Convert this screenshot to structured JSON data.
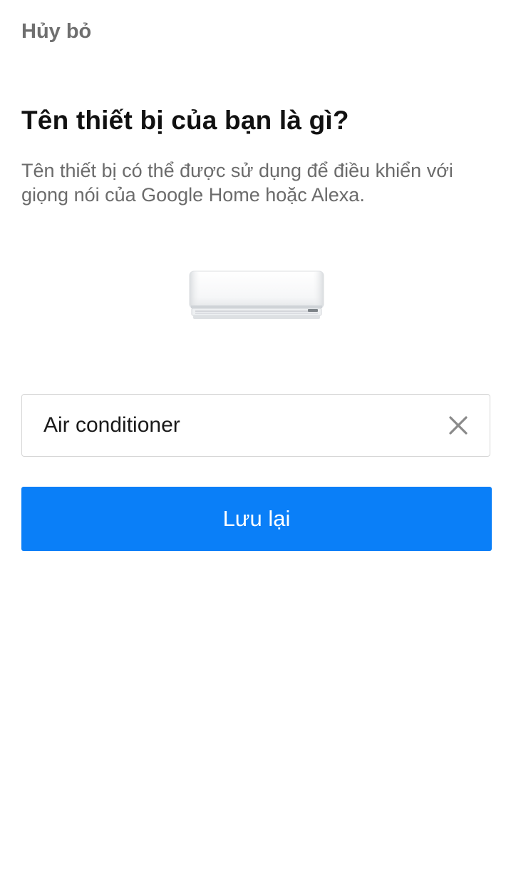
{
  "header": {
    "cancel_label": "Hủy bỏ"
  },
  "main": {
    "title": "Tên thiết bị của bạn là gì?",
    "subtitle": "Tên thiết bị có thể được sử dụng để điều khiển với giọng nói của Google Home hoặc Alexa.",
    "device_icon": "air-conditioner-icon"
  },
  "name_field": {
    "value": "Air conditioner",
    "clear_icon": "close-icon"
  },
  "actions": {
    "save_label": "Lưu lại"
  },
  "colors": {
    "accent": "#0a7ff8",
    "title": "#111111",
    "secondary_text": "#6b6b6b",
    "cancel_text": "#6f6f6f",
    "field_border": "#d6d6d6"
  }
}
